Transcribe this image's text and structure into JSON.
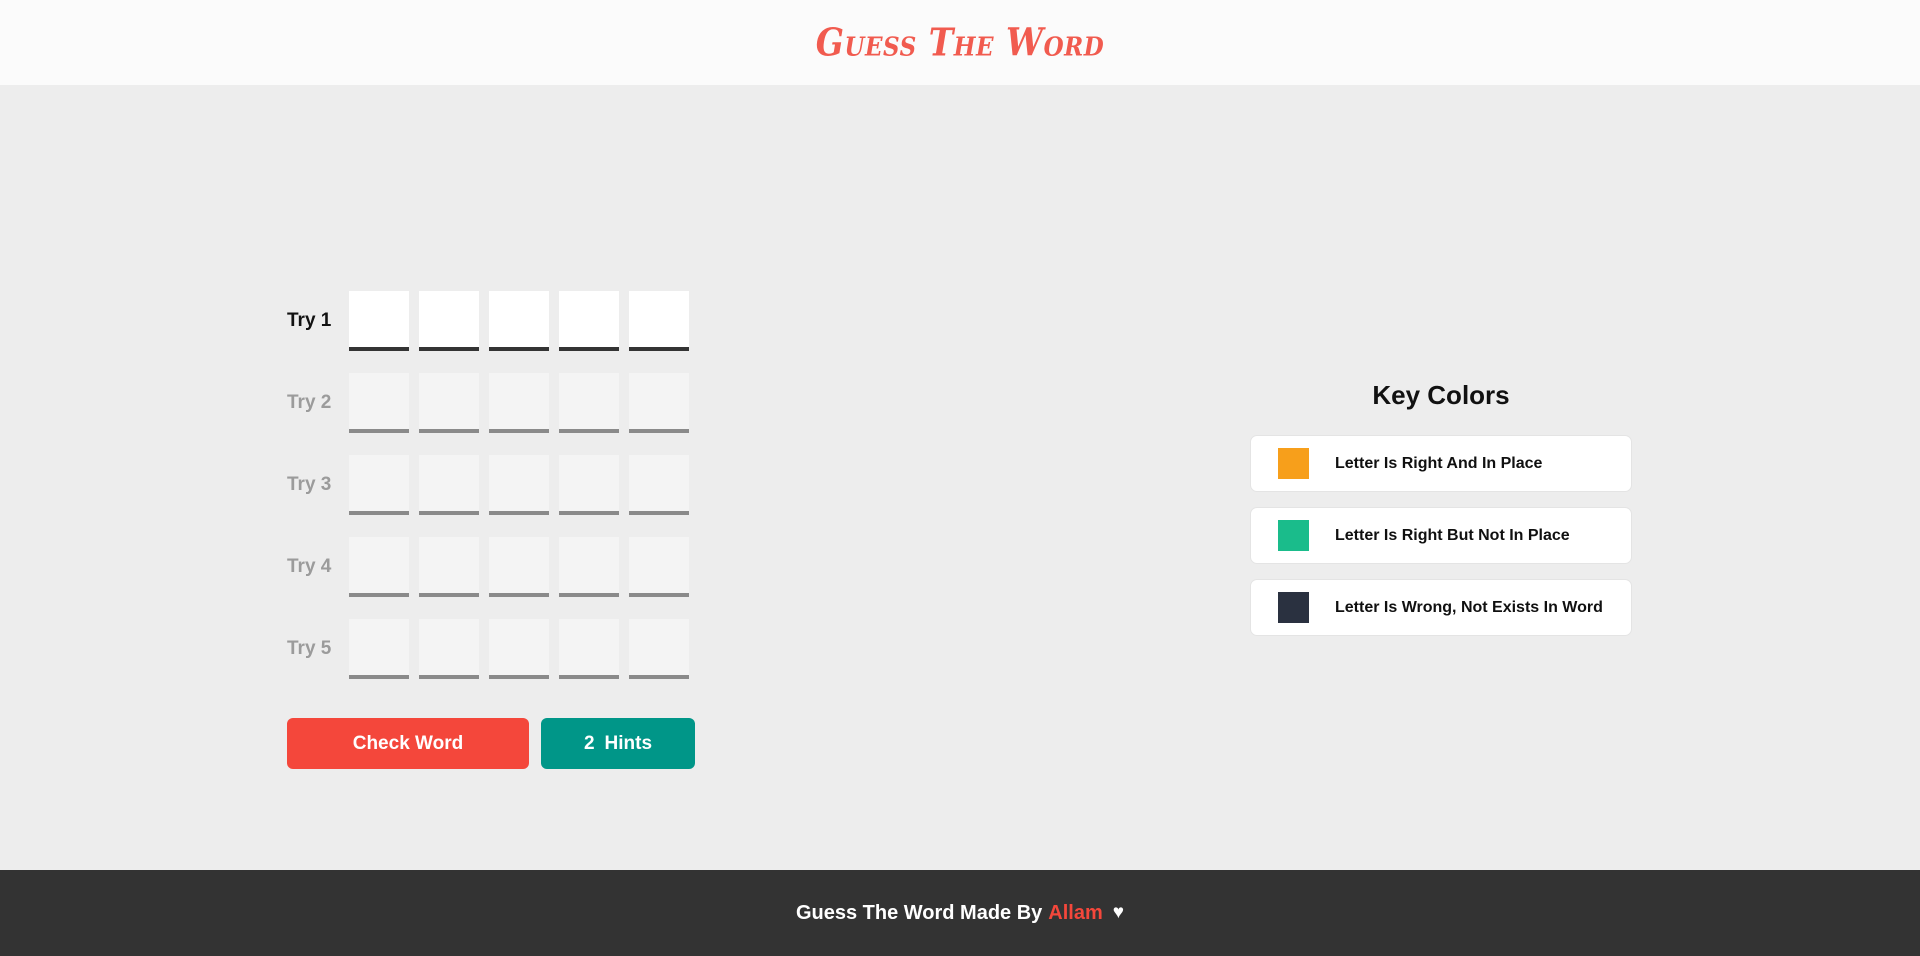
{
  "header": {
    "title": "Guess The Word"
  },
  "game": {
    "rows": [
      {
        "label": "Try 1",
        "active": true,
        "letters": [
          "",
          "",
          "",
          "",
          ""
        ]
      },
      {
        "label": "Try 2",
        "active": false,
        "letters": [
          "",
          "",
          "",
          "",
          ""
        ]
      },
      {
        "label": "Try 3",
        "active": false,
        "letters": [
          "",
          "",
          "",
          "",
          ""
        ]
      },
      {
        "label": "Try 4",
        "active": false,
        "letters": [
          "",
          "",
          "",
          "",
          ""
        ]
      },
      {
        "label": "Try 5",
        "active": false,
        "letters": [
          "",
          "",
          "",
          "",
          ""
        ]
      }
    ],
    "controls": {
      "check_label": "Check Word",
      "hints_count": "2",
      "hints_label": "Hints"
    }
  },
  "key_colors": {
    "title": "Key Colors",
    "items": [
      {
        "color": "#f79f1b",
        "label": "Letter Is Right And In Place"
      },
      {
        "color": "#1abc8b",
        "label": "Letter Is Right But Not In Place"
      },
      {
        "color": "#2a3140",
        "label": "Letter Is Wrong, Not Exists In Word"
      }
    ]
  },
  "footer": {
    "text": "Guess The Word Made By",
    "author": "Allam",
    "heart": "♥"
  },
  "colors": {
    "accent_red": "#f4473b",
    "accent_teal": "#009688",
    "title_coral": "#f15b4f",
    "page_bg": "#ededed",
    "header_bg": "#fbfbfb",
    "footer_bg": "#333333"
  }
}
